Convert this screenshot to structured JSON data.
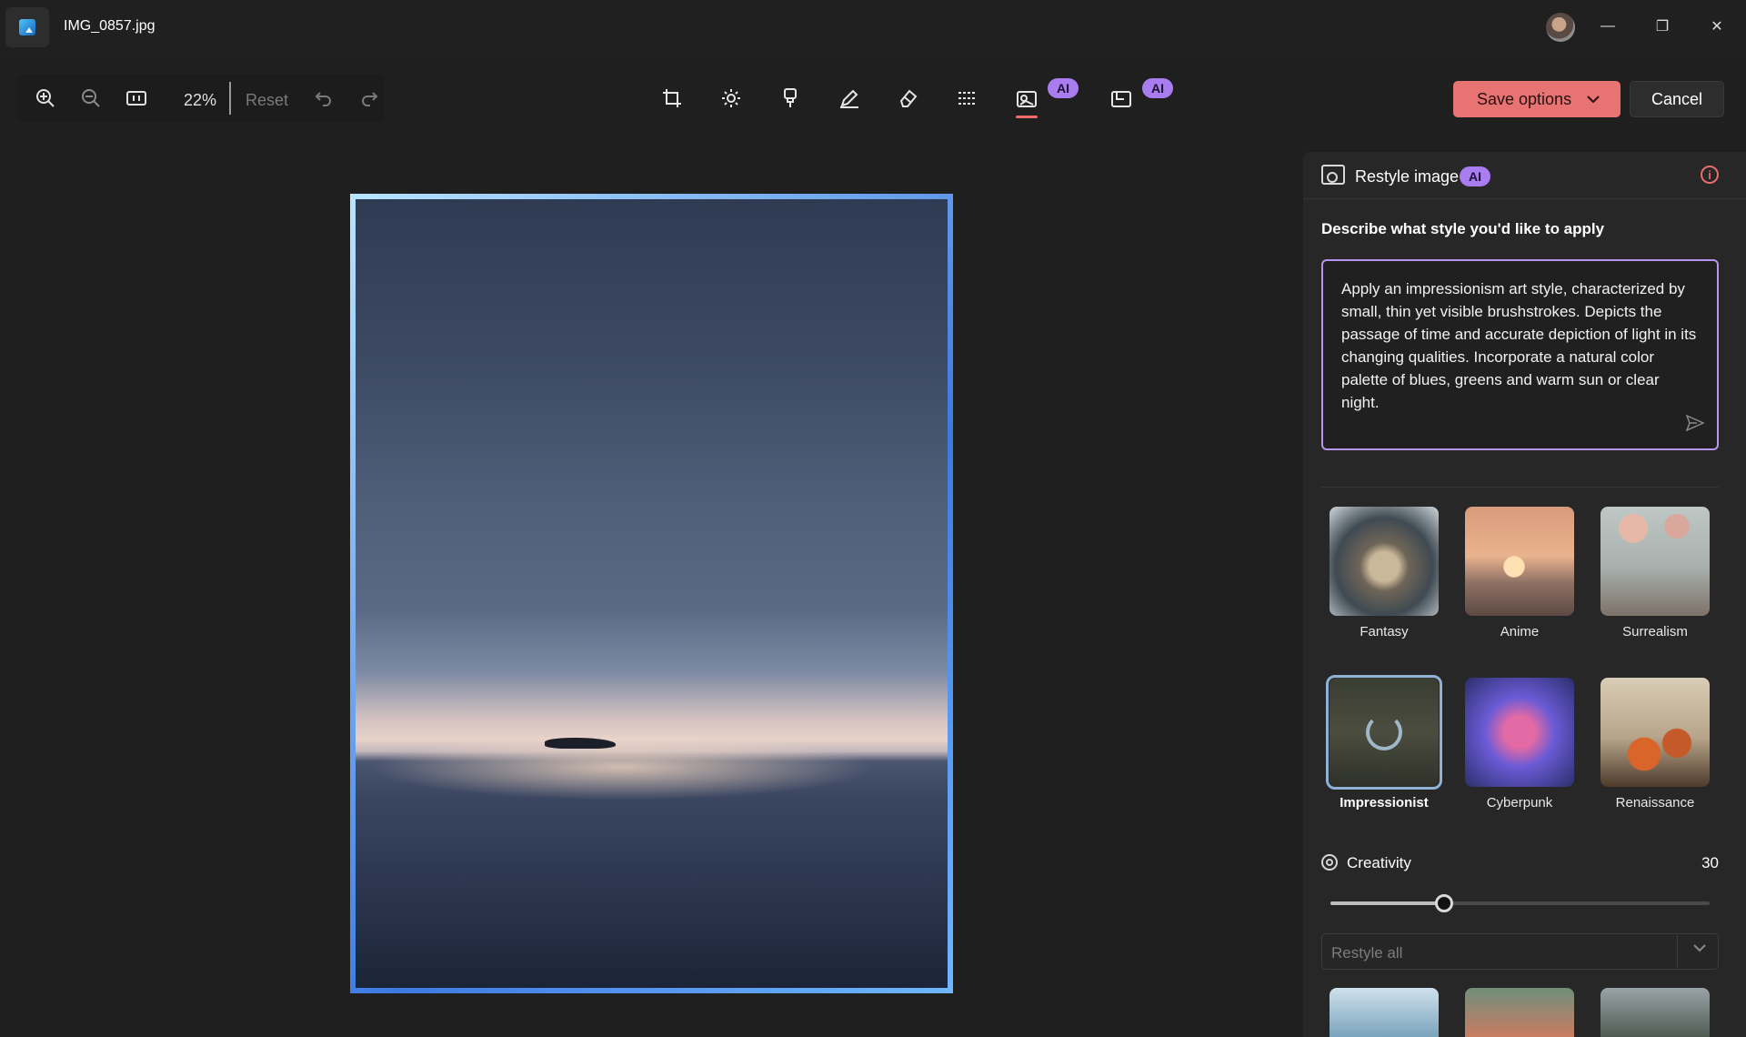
{
  "window": {
    "file_name": "IMG_0857.jpg"
  },
  "toolbar": {
    "zoom_level": "22%",
    "reset_label": "Reset",
    "save_label": "Save options",
    "cancel_label": "Cancel",
    "ai_badge": "AI"
  },
  "panel": {
    "title": "Restyle image",
    "ai_badge": "AI",
    "prompt_heading": "Describe what style you'd like to apply",
    "prompt_text": "Apply an impressionism art style, characterized by small, thin yet visible brushstrokes. Depicts the passage of time and accurate depiction of light in its changing qualities. Incorporate a natural color palette of blues, greens and warm sun or clear night.",
    "styles": [
      {
        "label": "Fantasy",
        "selected": false
      },
      {
        "label": "Anime",
        "selected": false
      },
      {
        "label": "Surrealism",
        "selected": false
      },
      {
        "label": "Impressionist",
        "selected": true
      },
      {
        "label": "Cyberpunk",
        "selected": false
      },
      {
        "label": "Renaissance",
        "selected": false
      }
    ],
    "creativity": {
      "label": "Creativity",
      "value": "30",
      "fraction": 0.3
    },
    "restyle_select": {
      "placeholder": "Restyle all"
    }
  },
  "colors": {
    "accent": "#e87373",
    "ai_badge": "#a97df0",
    "prompt_border": "#b795ee",
    "active_tab_underline": "#f26b6b"
  }
}
